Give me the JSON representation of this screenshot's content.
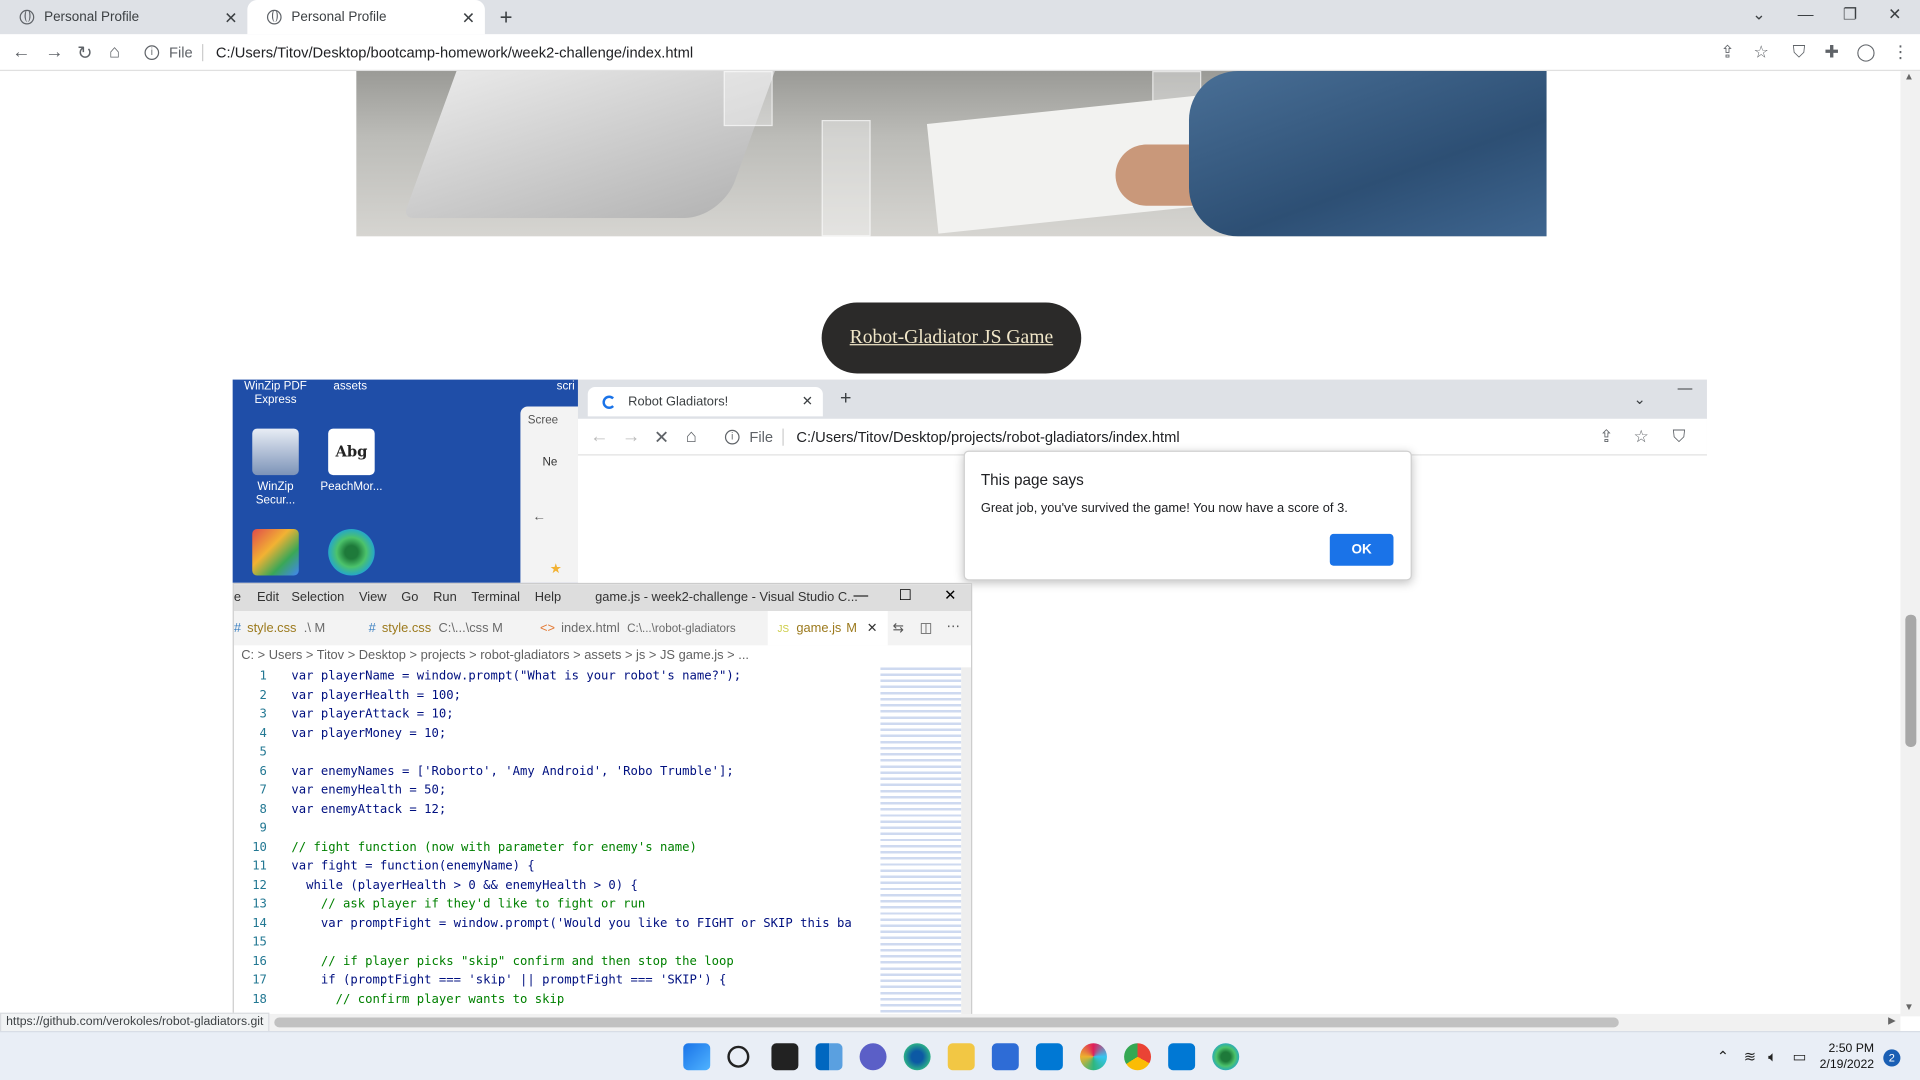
{
  "browser": {
    "tabs": [
      {
        "title": "Personal Profile"
      },
      {
        "title": "Personal Profile"
      }
    ],
    "address": {
      "scheme_label": "File",
      "url": "C:/Users/Titov/Desktop/bootcamp-homework/week2-challenge/index.html"
    }
  },
  "page": {
    "game_button": "Robot-Gladiator JS Game"
  },
  "desktop": {
    "icons": [
      {
        "label": "WinZip PDF Express"
      },
      {
        "label": "assets"
      },
      {
        "label": "scri"
      },
      {
        "label": "WinZip Secur..."
      },
      {
        "label": "PeachMor..."
      }
    ],
    "explorer_label": "Scree",
    "explorer_new": "Ne",
    "icon_glyph": "Abg"
  },
  "game_browser": {
    "tab_title": "Robot Gladiators!",
    "scheme_label": "File",
    "url": "C:/Users/Titov/Desktop/projects/robot-gladiators/index.html"
  },
  "dialog": {
    "title": "This page says",
    "message": "Great job, you've survived the game! You now have a score of 3.",
    "ok": "OK"
  },
  "vscode": {
    "menu": [
      "e",
      "Edit",
      "Selection",
      "View",
      "Go",
      "Run",
      "Terminal",
      "Help"
    ],
    "title": "game.js - week2-challenge - Visual Studio C...",
    "tabs": [
      {
        "name": "style.css",
        "detail": ".\\ M"
      },
      {
        "name": "style.css",
        "detail": "C:\\...\\css M"
      },
      {
        "name": "index.html",
        "detail": "C:\\...\\robot-gladiators"
      },
      {
        "name": "game.js",
        "detail": "M"
      }
    ],
    "breadcrumb": "C: > Users > Titov > Desktop > projects > robot-gladiators > assets > js > JS game.js > ...",
    "lines": [
      "var playerName = window.prompt(\"What is your robot's name?\");",
      "var playerHealth = 100;",
      "var playerAttack = 10;",
      "var playerMoney = 10;",
      "",
      "var enemyNames = ['Roborto', 'Amy Android', 'Robo Trumble'];",
      "var enemyHealth = 50;",
      "var enemyAttack = 12;",
      "",
      "// fight function (now with parameter for enemy's name)",
      "var fight = function(enemyName) {",
      "  while (playerHealth > 0 && enemyHealth > 0) {",
      "    // ask player if they'd like to fight or run",
      "    var promptFight = window.prompt('Would you like to FIGHT or SKIP this ba",
      "",
      "    // if player picks \"skip\" confirm and then stop the loop",
      "    if (promptFight === 'skip' || promptFight === 'SKIP') {",
      "      // confirm player wants to skip"
    ]
  },
  "status_url": "https://github.com/verokoles/robot-gladiators.git",
  "clock": {
    "time": "2:50 PM",
    "date": "2/19/2022"
  },
  "notification_count": "2"
}
